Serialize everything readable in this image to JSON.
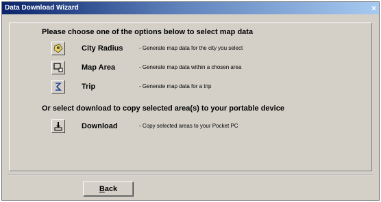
{
  "window": {
    "title": "Data Download Wizard",
    "close_glyph": "×"
  },
  "main": {
    "heading_options": "Please choose one of the options below to select map data",
    "heading_download": "Or select download to copy selected area(s) to your portable device",
    "options": [
      {
        "label": "City Radius",
        "description": "- Generate map data for the city you select",
        "icon": "city-radius-icon"
      },
      {
        "label": "Map Area",
        "description": "- Generate map data within a chosen area",
        "icon": "map-area-icon"
      },
      {
        "label": "Trip",
        "description": "- Generate map data for a trip",
        "icon": "trip-icon"
      }
    ],
    "download": {
      "label": "Download",
      "description": "- Copy selected areas to your Pocket PC",
      "icon": "download-icon"
    }
  },
  "footer": {
    "back_first_letter": "B",
    "back_rest": "ack"
  }
}
